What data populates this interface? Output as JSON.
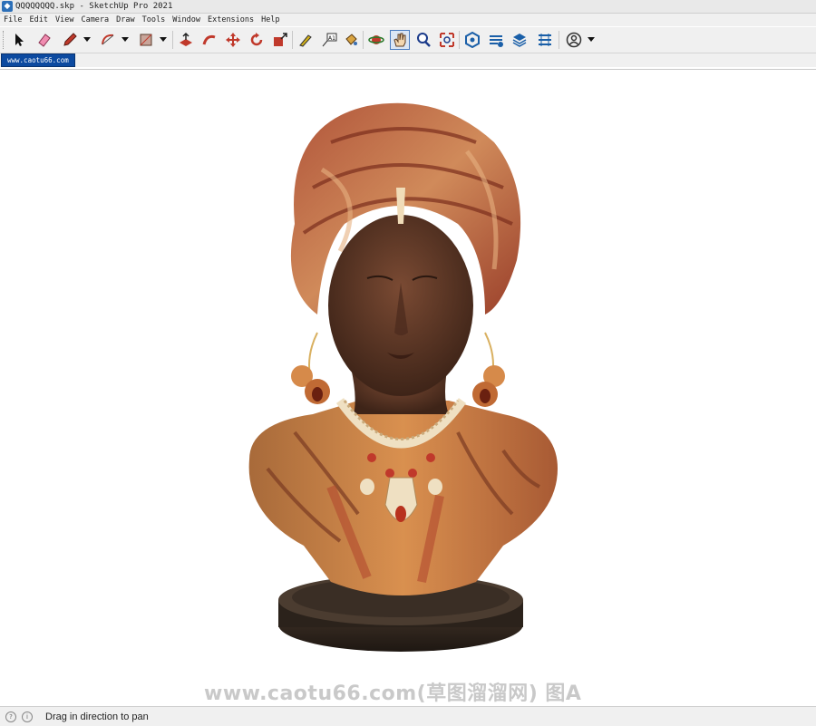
{
  "window": {
    "title": "QQQQQQQQ.skp - SketchUp Pro 2021"
  },
  "menu": [
    "File",
    "Edit",
    "View",
    "Camera",
    "Draw",
    "Tools",
    "Window",
    "Extensions",
    "Help"
  ],
  "scene_tab": {
    "label": "www.caotu66.com"
  },
  "watermark": {
    "text": "www.caotu66.com(草图溜溜网) 图A"
  },
  "status": {
    "hint": "Drag in direction to pan"
  },
  "colors": {
    "scene_tab_bg": "#0c4aa0",
    "accent": "#4a7cc0"
  },
  "toolbar_icons": [
    "select-arrow-icon",
    "eraser-icon",
    "pencil-icon",
    "arc-icon",
    "rectangle-icon",
    "push-pull-icon",
    "follow-me-icon",
    "move-icon",
    "rotate-icon",
    "scale-icon",
    "tape-measure-icon",
    "text-label-icon",
    "paint-bucket-icon",
    "orbit-icon",
    "pan-icon",
    "zoom-icon",
    "zoom-extents-icon",
    "warehouse-icon",
    "extension-warehouse-icon",
    "layout-icon",
    "extension-manager-icon",
    "user-account-icon"
  ]
}
